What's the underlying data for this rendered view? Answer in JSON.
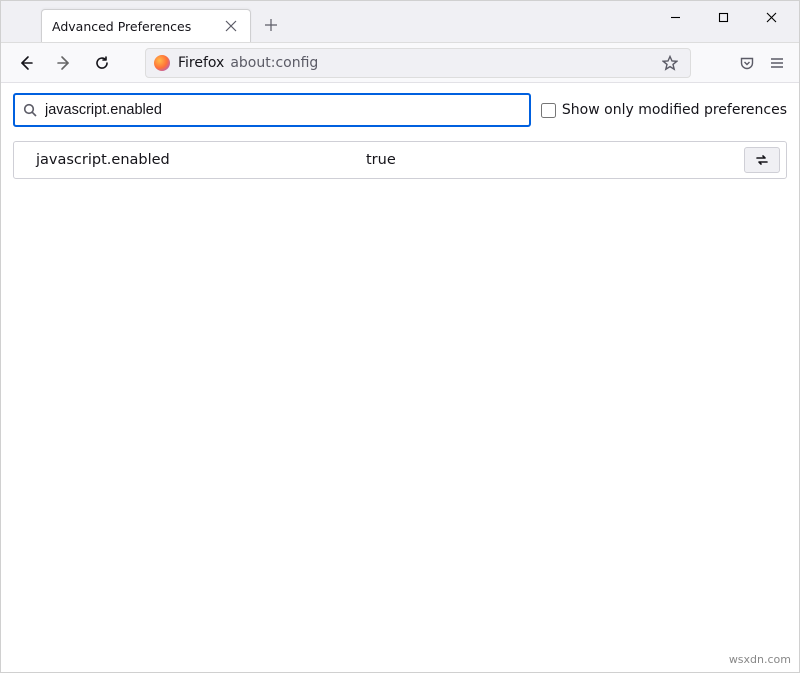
{
  "tab": {
    "title": "Advanced Preferences"
  },
  "urlbar": {
    "brand": "Firefox",
    "path": "about:config"
  },
  "config": {
    "search_value": "javascript.enabled",
    "show_modified_label": "Show only modified preferences",
    "show_modified_checked": false,
    "pref": {
      "name": "javascript.enabled",
      "value": "true"
    }
  },
  "watermark": "wsxdn.com"
}
